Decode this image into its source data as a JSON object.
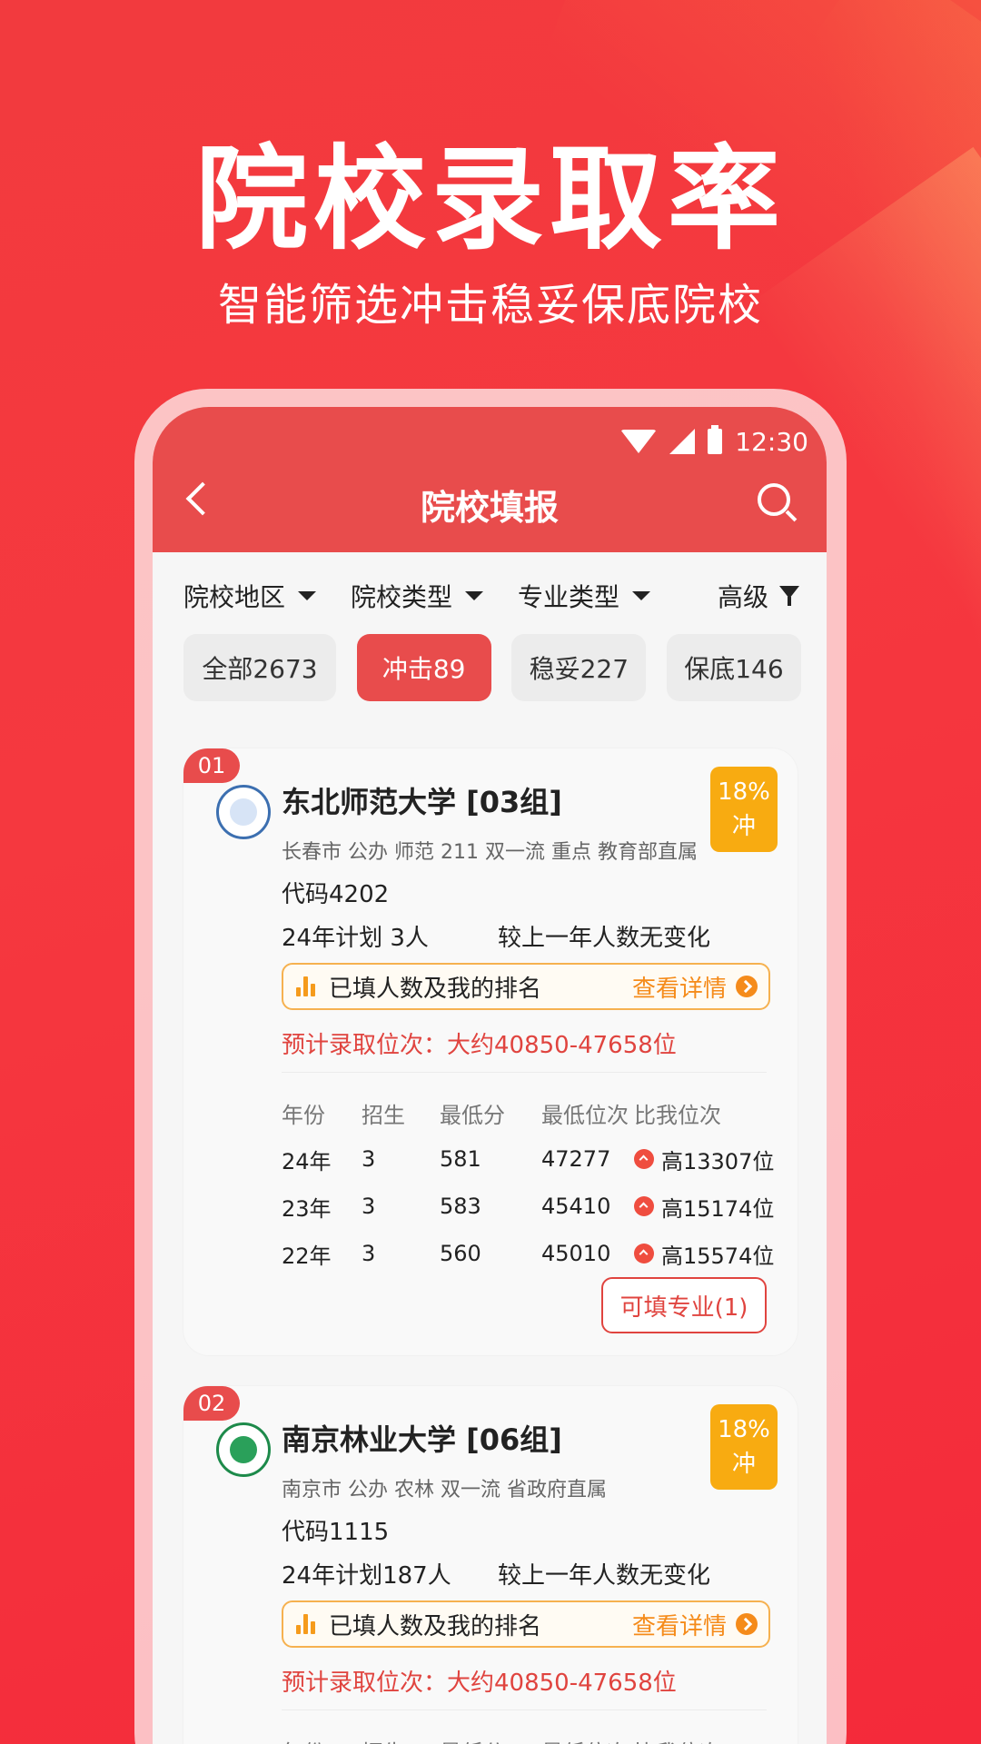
{
  "hero": {
    "title": "院校录取率",
    "subtitle": "智能筛选冲击稳妥保底院校"
  },
  "statusbar": {
    "time": "12:30"
  },
  "appbar": {
    "title": "院校填报"
  },
  "filters": [
    {
      "label": "院校地区"
    },
    {
      "label": "院校类型"
    },
    {
      "label": "专业类型"
    }
  ],
  "advanced_filter": "高级",
  "tabs": [
    {
      "label": "全部2673",
      "active": false
    },
    {
      "label": "冲击89",
      "active": true
    },
    {
      "label": "稳妥227",
      "active": false
    },
    {
      "label": "保底146",
      "active": false
    }
  ],
  "colors": {
    "primary": "#e84c4c",
    "badge": "#f8ab11",
    "accent": "#f58b1a"
  },
  "cards": [
    {
      "rank": "01",
      "name": "东北师范大学 [03组]",
      "tags": "长春市 公办 师范 211 双一流 重点 教育部直属",
      "rate": "18%",
      "rate_type": "冲",
      "code": "代码4202",
      "plan": "24年计划 3人",
      "change": "较上一年人数无变化",
      "rank_label": "已填人数及我的排名",
      "detail_link": "查看详情",
      "estimate": "预计录取位次：大约40850-47658位",
      "table_header": [
        "年份",
        "招生",
        "最低分",
        "最低位次",
        "比我位次"
      ],
      "rows": [
        [
          "24年",
          "3",
          "581",
          "47277",
          "高13307位"
        ],
        [
          "23年",
          "3",
          "583",
          "45410",
          "高15174位"
        ],
        [
          "22年",
          "3",
          "560",
          "45010",
          "高15574位"
        ]
      ],
      "major_button": "可填专业(1)"
    },
    {
      "rank": "02",
      "name": "南京林业大学 [06组]",
      "tags": "南京市 公办 农林 双一流 省政府直属",
      "rate": "18%",
      "rate_type": "冲",
      "code": "代码1115",
      "plan": "24年计划187人",
      "change": "较上一年人数无变化",
      "rank_label": "已填人数及我的排名",
      "detail_link": "查看详情",
      "estimate": "预计录取位次：大约40850-47658位",
      "table_header": [
        "年份",
        "招生",
        "最低分",
        "最低位次",
        "比我位次"
      ]
    }
  ]
}
